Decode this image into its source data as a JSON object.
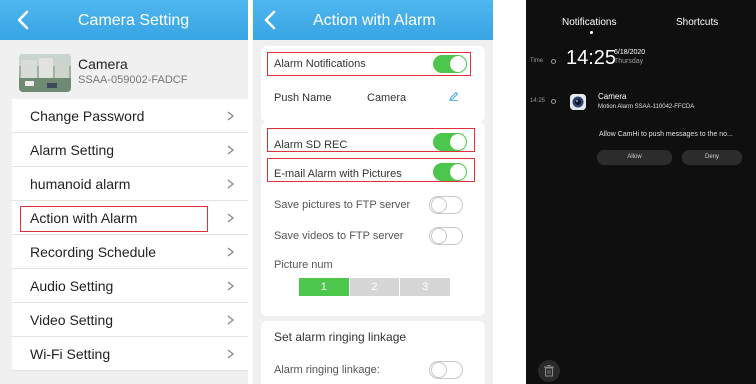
{
  "panel1": {
    "title": "Camera Setting",
    "device": {
      "name": "Camera",
      "id": "SSAA-059002-FADCF"
    },
    "menu": [
      {
        "label": "Change Password"
      },
      {
        "label": "Alarm Setting"
      },
      {
        "label": "humanoid alarm"
      },
      {
        "label": "Action with Alarm"
      },
      {
        "label": "Recording Schedule"
      },
      {
        "label": "Audio Setting"
      },
      {
        "label": "Video Setting"
      },
      {
        "label": "Wi-Fi Setting"
      }
    ]
  },
  "panel2": {
    "title": "Action with Alarm",
    "alarm_notifications": {
      "label": "Alarm Notifications",
      "on": true
    },
    "push_name": {
      "label": "Push Name",
      "value": "Camera"
    },
    "alarm_sd_rec": {
      "label": "Alarm SD REC",
      "on": true
    },
    "email_alarm": {
      "label": "E-mail Alarm with Pictures",
      "on": true
    },
    "ftp_pictures": {
      "label": "Save pictures to FTP server",
      "on": false
    },
    "ftp_videos": {
      "label": "Save videos to FTP server",
      "on": false
    },
    "picture_num": {
      "label": "Picture num",
      "options": [
        "1",
        "2",
        "3"
      ],
      "selected": "1"
    },
    "ringing": {
      "header": "Set alarm ringing linkage",
      "label": "Alarm ringing linkage:",
      "on": false
    }
  },
  "panel3": {
    "tabs": [
      "Notifications",
      "Shortcuts"
    ],
    "timeline_time_label": "Time",
    "time": "14:25",
    "date": "6/18/2020",
    "day": "Thursday",
    "notification": {
      "time_label": "14:25",
      "app": "Camera",
      "message": "Motion Alarm  SSAA-110042-FFCDA",
      "prompt": "Allow CamHi to push messages to the no...",
      "allow_label": "Allow",
      "deny_label": "Deny"
    }
  },
  "colors": {
    "header_blue": "#3ea9e8",
    "toggle_on_green": "#4cc64c",
    "highlight_red": "#e0303a",
    "notification_bg": "#0f0f0f"
  }
}
